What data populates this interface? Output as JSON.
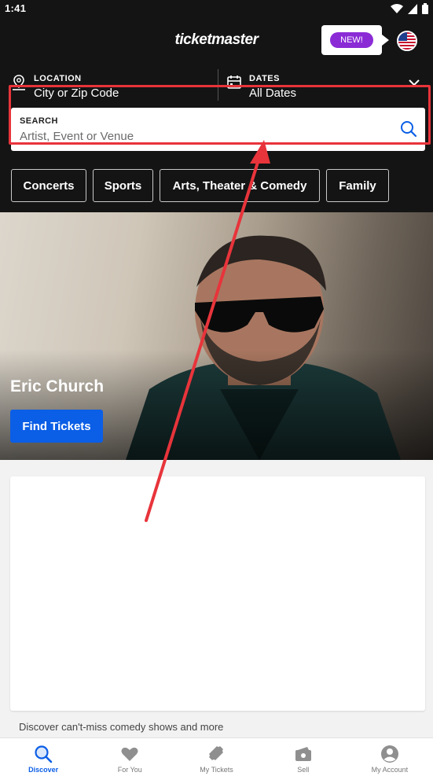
{
  "status_bar": {
    "time": "1:41"
  },
  "header": {
    "brand": "ticketmaster",
    "new_badge": "NEW!",
    "location": {
      "label": "LOCATION",
      "value": "City or Zip Code"
    },
    "dates": {
      "label": "DATES",
      "value": "All Dates"
    },
    "search": {
      "label": "SEARCH",
      "placeholder": "Artist, Event or Venue"
    }
  },
  "categories": [
    "Concerts",
    "Sports",
    "Arts, Theater & Comedy",
    "Family"
  ],
  "hero": {
    "title": "Eric Church",
    "button": "Find Tickets"
  },
  "caption": "Discover can't-miss comedy shows and more",
  "bottom_nav": [
    {
      "label": "Discover",
      "icon": "search-icon",
      "active": true
    },
    {
      "label": "For You",
      "icon": "heart-icon",
      "active": false
    },
    {
      "label": "My Tickets",
      "icon": "ticket-icon",
      "active": false
    },
    {
      "label": "Sell",
      "icon": "wallet-icon",
      "active": false
    },
    {
      "label": "My Account",
      "icon": "account-icon",
      "active": false
    }
  ],
  "colors": {
    "header_bg": "#141414",
    "accent_blue": "#0b5ee6",
    "new_badge": "#8a2bd6",
    "annotation_red": "#e8343b"
  }
}
